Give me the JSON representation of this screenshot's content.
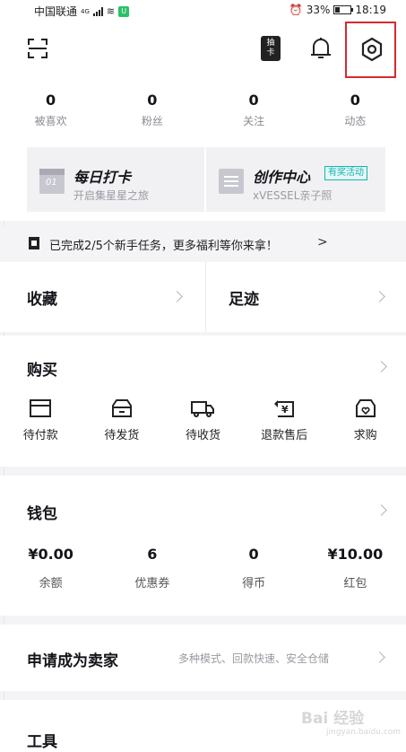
{
  "status_bar": {
    "carrier": "中国联通",
    "network": "4G",
    "battery": "33%",
    "battery_level": 0.33,
    "time": "18:19"
  },
  "top_bar": {
    "card_badge": "抽卡",
    "icons": [
      "scan-icon",
      "card-icon",
      "bell-icon",
      "gear-icon"
    ],
    "highlight_color": "#d62a2a"
  },
  "stats": [
    {
      "value": "0",
      "label": "被喜欢"
    },
    {
      "value": "0",
      "label": "粉丝"
    },
    {
      "value": "0",
      "label": "关注"
    },
    {
      "value": "0",
      "label": "动态"
    }
  ],
  "quick_cards": {
    "checkin": {
      "title": "每日打卡",
      "subtitle": "开启集星星之旅",
      "icon_text": "01"
    },
    "creator": {
      "title": "创作中心",
      "tag": "有奖活动",
      "subtitle": "xVESSEL亲子照"
    }
  },
  "task_banner": {
    "text": "已完成2/5个新手任务，更多福利等你来拿！",
    "chevron": ">"
  },
  "favorites": {
    "left": "收藏",
    "right": "足迹"
  },
  "buy": {
    "title": "购买",
    "orders": [
      {
        "label": "待付款",
        "icon": "card-payment-icon"
      },
      {
        "label": "待发货",
        "icon": "box-icon"
      },
      {
        "label": "待收货",
        "icon": "truck-icon"
      },
      {
        "label": "退款售后",
        "icon": "refund-icon"
      },
      {
        "label": "求购",
        "icon": "wish-box-icon"
      }
    ]
  },
  "wallet": {
    "title": "钱包",
    "items": [
      {
        "value": "¥0.00",
        "label": "余额"
      },
      {
        "value": "6",
        "label": "优惠券"
      },
      {
        "value": "0",
        "label": "得币"
      },
      {
        "value": "¥10.00",
        "label": "红包"
      }
    ]
  },
  "seller": {
    "title": "申请成为卖家",
    "desc": "多种模式、回款快速、安全仓储"
  },
  "tools": {
    "title": "工具"
  },
  "watermark": {
    "text": "Bai 经验",
    "sub": "jingyan.baidu.com"
  }
}
